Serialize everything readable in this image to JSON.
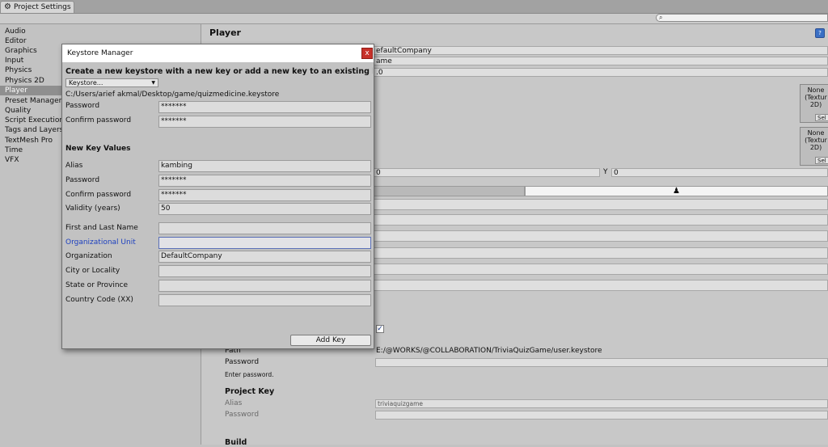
{
  "window": {
    "tab_title": "Project Settings"
  },
  "sidebar": {
    "categories": [
      "Audio",
      "Editor",
      "Graphics",
      "Input",
      "Physics",
      "Physics 2D",
      "Player",
      "Preset Manager",
      "Quality",
      "Script Execution",
      "Tags and Layers",
      "TextMesh Pro",
      "Time",
      "VFX"
    ],
    "selected": "Player"
  },
  "inspector": {
    "title": "Player",
    "company_name_partial": "efaultCompany",
    "product_name_partial": "ame",
    "version_partial": ".0",
    "texture_box": {
      "line1": "None",
      "line2": "(Textur",
      "line3": "2D)",
      "select": "Sel"
    },
    "cursor_hotspot": {
      "x_value": "0",
      "y_label": "Y",
      "y_value": "0"
    },
    "publishing": {
      "path_label": "Path",
      "path_value": "E:/@WORKS/@COLLABORATION/TriviaQuizGame/user.keystore",
      "password_label": "Password",
      "enter_password_hint": "Enter password.",
      "project_key_heading": "Project Key",
      "alias_label": "Alias",
      "alias_value": "triviaquizgame",
      "key_password_label": "Password",
      "build_heading": "Build"
    }
  },
  "dialog": {
    "title": "Keystore Manager",
    "close_label": "x",
    "headline": "Create a new keystore with a new key or add a new key to an existing keystore",
    "keystore_dropdown": "Keystore...",
    "keystore_path": "C:/Users/arief akmal/Desktop/game/quizmedicine.keystore",
    "password_label": "Password",
    "password_value": "*******",
    "confirm_password_label": "Confirm password",
    "confirm_password_value": "*******",
    "new_key_heading": "New Key Values",
    "fields": [
      {
        "label": "Alias",
        "value": "kambing"
      },
      {
        "label": "Password",
        "value": "*******"
      },
      {
        "label": "Confirm password",
        "value": "*******"
      },
      {
        "label": "Validity (years)",
        "value": "50"
      },
      {
        "label": "First and Last Name",
        "value": ""
      },
      {
        "label": "Organizational Unit",
        "value": ""
      },
      {
        "label": "Organization",
        "value": "DefaultCompany"
      },
      {
        "label": "City or Locality",
        "value": ""
      },
      {
        "label": "State or Province",
        "value": ""
      },
      {
        "label": "Country Code (XX)",
        "value": ""
      }
    ],
    "add_key_label": "Add Key"
  }
}
